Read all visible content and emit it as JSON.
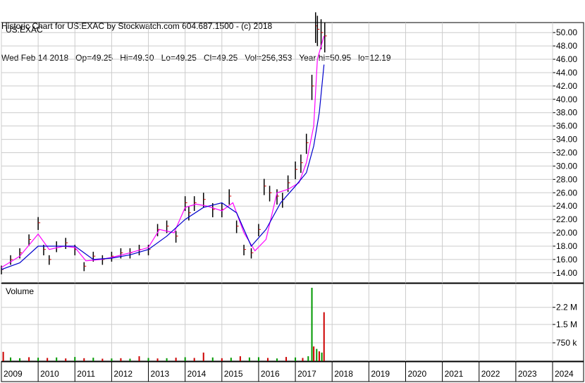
{
  "header": {
    "line1": "Historic Chart for US:EXAC by Stockwatch.com 604.687.1500 - (c) 2018",
    "line2": "Wed Feb 14 2018   Op=49.25   Hi=49.30   Lo=49.25   Cl=49.25   Vol=256,353   Year hi=50.95   lo=12.19"
  },
  "colors": {
    "price_bar": "#000000",
    "price_tick": "#cc0000",
    "ma_short": "#ff00ff",
    "ma_long": "#0000cc",
    "volume_up": "#009900",
    "volume_down": "#cc0000",
    "grid": "#cccccc"
  },
  "chart_data": [
    {
      "type": "line",
      "panel": "price",
      "title": "US:EXAC",
      "ylim": [
        12.5,
        51.5
      ],
      "y_ticks": [
        "14.00",
        "16.00",
        "18.00",
        "20.00",
        "22.00",
        "24.00",
        "26.00",
        "28.00",
        "30.00",
        "32.00",
        "34.00",
        "36.00",
        "38.00",
        "40.00",
        "42.00",
        "44.00",
        "46.00",
        "48.00",
        "50.00"
      ],
      "x_ticks": [
        "2009",
        "2010",
        "2011",
        "2012",
        "2013",
        "2014",
        "2015",
        "2016",
        "2017",
        "2018",
        "2019",
        "2020",
        "2021",
        "2022",
        "2023",
        "2024"
      ],
      "xlim": [
        2009.0,
        2024.0
      ],
      "grid": true,
      "series": [
        {
          "style": "price-bars",
          "x": [
            2009.0,
            2009.25,
            2009.5,
            2009.75,
            2010.0,
            2010.15,
            2010.3,
            2010.5,
            2010.75,
            2011.0,
            2011.25,
            2011.5,
            2011.75,
            2012.0,
            2012.25,
            2012.5,
            2012.75,
            2013.0,
            2013.25,
            2013.5,
            2013.75,
            2014.0,
            2014.1,
            2014.25,
            2014.5,
            2014.75,
            2015.0,
            2015.2,
            2015.4,
            2015.6,
            2015.8,
            2016.0,
            2016.15,
            2016.3,
            2016.5,
            2016.65,
            2016.8,
            2017.0,
            2017.15,
            2017.3,
            2017.45,
            2017.55,
            2017.6,
            2017.7,
            2017.8
          ],
          "values": [
            14.5,
            16.0,
            17.0,
            19.0,
            21.5,
            17.5,
            16.0,
            18.0,
            18.5,
            17.5,
            15.0,
            16.5,
            16.0,
            16.5,
            17.0,
            17.0,
            17.5,
            17.5,
            20.5,
            21.0,
            19.5,
            24.5,
            23.0,
            24.5,
            25.0,
            23.5,
            23.5,
            25.5,
            21.0,
            17.5,
            17.0,
            20.5,
            27.0,
            26.0,
            25.5,
            25.0,
            27.5,
            29.5,
            30.5,
            33.5,
            42.0,
            51.0,
            50.5,
            50.0,
            49.5
          ]
        },
        {
          "style": "moving-average-short",
          "x": [
            2009.0,
            2009.5,
            2010.0,
            2010.3,
            2010.7,
            2011.0,
            2011.3,
            2011.7,
            2012.0,
            2012.5,
            2013.0,
            2013.3,
            2013.7,
            2014.0,
            2014.3,
            2014.6,
            2015.0,
            2015.3,
            2015.6,
            2015.9,
            2016.2,
            2016.5,
            2016.8,
            2017.1,
            2017.3,
            2017.5,
            2017.6,
            2017.78
          ],
          "values": [
            14.8,
            16.5,
            19.8,
            17.5,
            18.0,
            17.8,
            15.8,
            16.0,
            16.3,
            17.0,
            17.8,
            20.5,
            20.0,
            23.8,
            24.3,
            24.0,
            23.3,
            24.5,
            20.0,
            17.3,
            19.0,
            26.0,
            26.5,
            27.5,
            30.5,
            36.0,
            46.0,
            49.5
          ]
        },
        {
          "style": "moving-average-long",
          "x": [
            2009.0,
            2009.5,
            2010.0,
            2010.5,
            2011.0,
            2011.5,
            2012.0,
            2012.5,
            2013.0,
            2013.5,
            2014.0,
            2014.5,
            2015.0,
            2015.4,
            2015.8,
            2016.2,
            2016.6,
            2017.0,
            2017.3,
            2017.5,
            2017.65,
            2017.78
          ],
          "values": [
            14.5,
            15.5,
            18.0,
            18.0,
            18.0,
            16.0,
            16.2,
            16.7,
            17.5,
            19.5,
            22.0,
            23.8,
            24.5,
            23.0,
            18.0,
            20.5,
            24.5,
            27.0,
            29.0,
            33.0,
            38.0,
            45.2
          ]
        }
      ]
    },
    {
      "type": "bar",
      "panel": "volume",
      "title": "Volume",
      "y_ticks": [
        "750 k",
        "1.5 M",
        "2.2 M"
      ],
      "ylim": [
        0,
        3000000
      ],
      "x": [
        2009.05,
        2009.25,
        2009.5,
        2009.75,
        2010.0,
        2010.25,
        2010.5,
        2010.75,
        2011.0,
        2011.25,
        2011.5,
        2011.75,
        2012.0,
        2012.25,
        2012.5,
        2012.75,
        2013.0,
        2013.25,
        2013.5,
        2013.75,
        2014.0,
        2014.25,
        2014.5,
        2014.75,
        2015.0,
        2015.25,
        2015.5,
        2015.75,
        2016.0,
        2016.25,
        2016.5,
        2016.75,
        2017.0,
        2017.2,
        2017.35,
        2017.45,
        2017.5,
        2017.58,
        2017.65,
        2017.72,
        2017.78
      ],
      "values": [
        380000,
        150000,
        120000,
        160000,
        140000,
        130000,
        150000,
        110000,
        170000,
        120000,
        140000,
        100000,
        110000,
        120000,
        100000,
        200000,
        130000,
        110000,
        120000,
        140000,
        160000,
        130000,
        350000,
        150000,
        120000,
        140000,
        200000,
        150000,
        160000,
        130000,
        110000,
        170000,
        150000,
        130000,
        200000,
        3000000,
        600000,
        500000,
        400000,
        350000,
        2000000
      ],
      "colors_by_bar": [
        "down",
        "up",
        "up",
        "down",
        "up",
        "down",
        "up",
        "down",
        "up",
        "down",
        "up",
        "down",
        "up",
        "down",
        "up",
        "down",
        "up",
        "down",
        "up",
        "down",
        "up",
        "down",
        "down",
        "up",
        "down",
        "up",
        "down",
        "up",
        "up",
        "down",
        "up",
        "down",
        "up",
        "down",
        "up",
        "up",
        "down",
        "up",
        "down",
        "up",
        "down"
      ]
    }
  ]
}
